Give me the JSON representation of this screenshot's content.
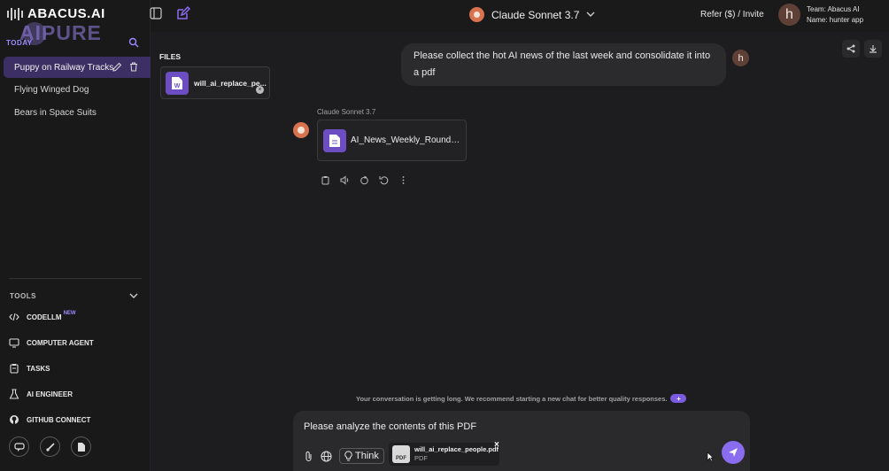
{
  "brand": {
    "name": "ABACUS.AI",
    "watermark": "AIPURE"
  },
  "sidebar": {
    "section_label": "TODAY",
    "chats": [
      {
        "label": "Puppy on Railway Tracks",
        "active": true
      },
      {
        "label": "Flying Winged Dog"
      },
      {
        "label": "Bears in Space Suits"
      }
    ],
    "tools_label": "TOOLS",
    "tools": [
      {
        "label": "CODELLM",
        "badge": "NEW",
        "icon": "code-icon"
      },
      {
        "label": "COMPUTER AGENT",
        "icon": "monitor-icon"
      },
      {
        "label": "TASKS",
        "icon": "clipboard-icon"
      },
      {
        "label": "AI ENGINEER",
        "icon": "flask-icon"
      },
      {
        "label": "GITHUB CONNECT",
        "icon": "github-icon"
      }
    ]
  },
  "header": {
    "model": "Claude Sonnet 3.7",
    "refer": "Refer ($) / Invite",
    "avatar_letter": "h",
    "team": "Team: Abacus AI",
    "name": "Name: hunter app"
  },
  "files": {
    "heading": "FILES",
    "file_name": "will_ai_replace_pe..."
  },
  "conversation": {
    "user_message": "Please collect the hot AI news of the last week and consolidate it into a pdf",
    "user_avatar": "h",
    "assistant_label": "Claude Sonnet 3.7",
    "assistant_file": "AI_News_Weekly_Roundu..."
  },
  "notice": {
    "text": "Your conversation is getting long. We recommend starting a new chat for better quality responses.",
    "plus": "+"
  },
  "composer": {
    "text": "Please analyze the contents of this PDF",
    "think_label": "Think",
    "attachment_name": "will_ai_replace_people.pdf",
    "attachment_type": "PDF",
    "pdf_badge": "PDF"
  },
  "colors": {
    "accent": "#8a6cf0",
    "active_chat": "#3b2f63"
  }
}
